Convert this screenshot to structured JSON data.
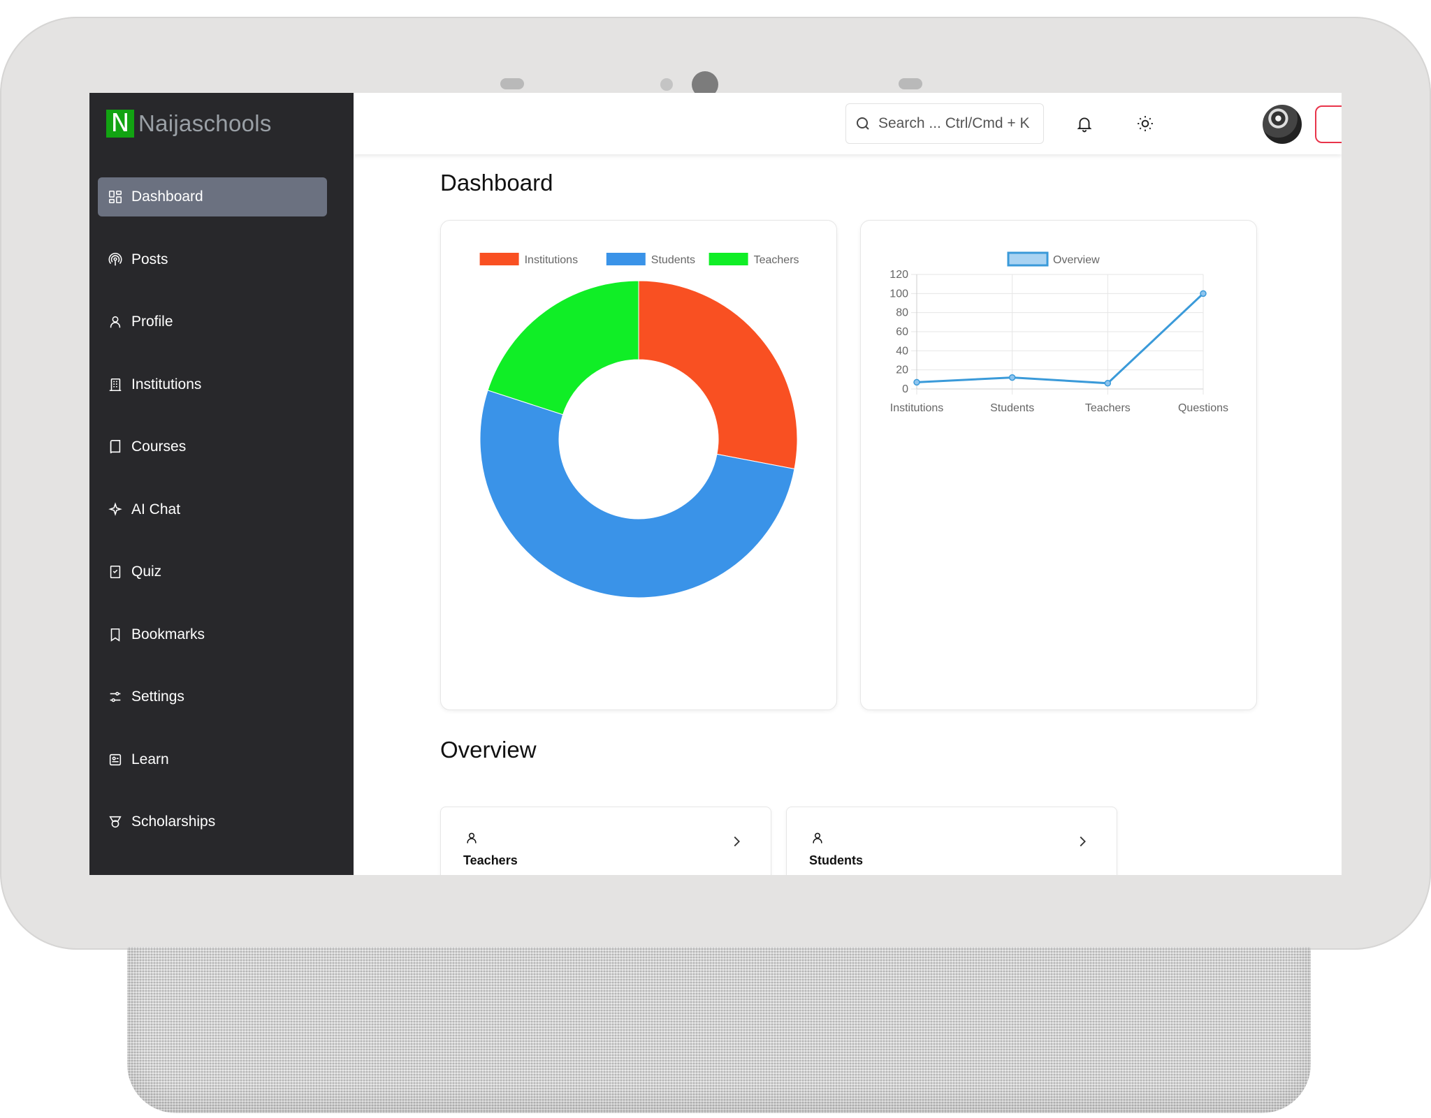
{
  "app": {
    "brand_letter": "N",
    "brand_name": "Naijaschools"
  },
  "sidebar": {
    "items": [
      {
        "label": "Dashboard",
        "icon": "dashboard-icon",
        "active": true
      },
      {
        "label": "Posts",
        "icon": "podcast-icon"
      },
      {
        "label": "Profile",
        "icon": "user-icon"
      },
      {
        "label": "Institutions",
        "icon": "building-icon"
      },
      {
        "label": "Courses",
        "icon": "book-icon"
      },
      {
        "label": "AI Chat",
        "icon": "sparkle-icon"
      },
      {
        "label": "Quiz",
        "icon": "checklist-icon"
      },
      {
        "label": "Bookmarks",
        "icon": "bookmark-icon"
      },
      {
        "label": "Settings",
        "icon": "sliders-icon"
      },
      {
        "label": "Learn",
        "icon": "learn-icon"
      },
      {
        "label": "Scholarships",
        "icon": "medal-icon"
      }
    ]
  },
  "topbar": {
    "search_placeholder": "Search ... Ctrl/Cmd + K",
    "icons": [
      "bell-icon",
      "sun-icon",
      "avatar",
      "arrow-right-icon"
    ]
  },
  "main": {
    "title": "Dashboard",
    "overview_title": "Overview",
    "overview_cards": [
      {
        "label": "Teachers",
        "icon": "person-icon"
      },
      {
        "label": "Students",
        "icon": "person-icon"
      }
    ]
  },
  "colors": {
    "institutions": "#f95022",
    "students": "#3a93e8",
    "teachers": "#10ee26",
    "line": "#3a9ad9",
    "logout": "#e8344a",
    "sidebar_bg": "#28282b",
    "active_item": "#6b7180",
    "brand_green": "#12a312"
  },
  "chart_data": [
    {
      "type": "pie",
      "variant": "doughnut",
      "categories": [
        "Institutions",
        "Students",
        "Teachers"
      ],
      "values": [
        28,
        52,
        20
      ],
      "legend": "top"
    },
    {
      "type": "line",
      "categories": [
        "Institutions",
        "Students",
        "Teachers",
        "Questions"
      ],
      "series": [
        {
          "name": "Overview",
          "values": [
            7,
            12,
            6,
            100
          ]
        }
      ],
      "ylim": [
        0,
        120
      ],
      "yticks": [
        0,
        20,
        40,
        60,
        80,
        100,
        120
      ],
      "grid": true,
      "legend": "top"
    }
  ]
}
